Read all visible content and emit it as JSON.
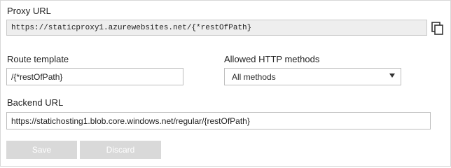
{
  "proxy": {
    "label": "Proxy URL",
    "value": "https://staticproxy1.azurewebsites.net/{*restOfPath}"
  },
  "route": {
    "label": "Route template",
    "value": "/{*restOfPath}"
  },
  "methods": {
    "label": "Allowed HTTP methods",
    "selected": "All methods"
  },
  "backend": {
    "label": "Backend URL",
    "value": "https://statichosting1.blob.core.windows.net/regular/{restOfPath}"
  },
  "actions": {
    "save_label": "Save",
    "discard_label": "Discard"
  },
  "icons": {
    "copy": "copy-icon",
    "dropdown": "chevron-down-icon"
  },
  "colors": {
    "disabled_button_bg": "#d9d9d9",
    "readonly_bg": "#eeeeee"
  }
}
